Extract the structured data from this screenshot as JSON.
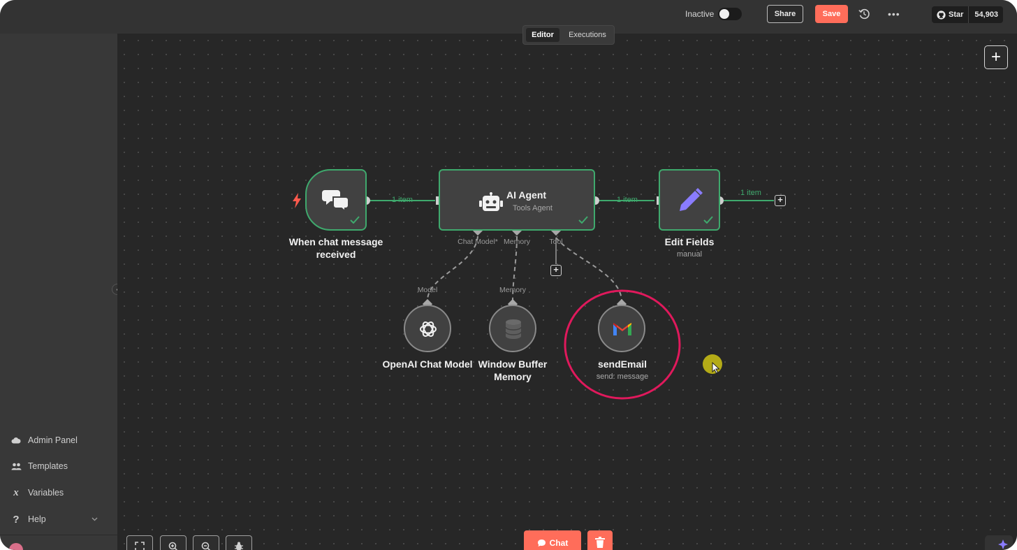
{
  "topbar": {
    "status_label": "Inactive",
    "share_label": "Share",
    "save_label": "Save",
    "more_label": "•••",
    "github": {
      "star_label": "Star",
      "count": "54,903"
    }
  },
  "tabs": [
    {
      "label": "Editor",
      "active": true
    },
    {
      "label": "Executions",
      "active": false
    }
  ],
  "sidebar": {
    "items": [
      {
        "label": "Admin Panel",
        "icon": "cloud-icon"
      },
      {
        "label": "Templates",
        "icon": "users-icon"
      },
      {
        "label": "Variables",
        "icon": "variable-x-icon"
      },
      {
        "label": "Help",
        "icon": "question-icon"
      }
    ]
  },
  "workflow": {
    "nodes": [
      {
        "id": "chat-trigger",
        "label": "When chat message received",
        "icon": "chat-bubbles-icon",
        "status": "success"
      },
      {
        "id": "ai-agent",
        "label": "AI Agent",
        "sublabel": "Tools Agent",
        "icon": "robot-icon",
        "status": "success"
      },
      {
        "id": "edit-fields",
        "label": "Edit Fields",
        "sublabel": "manual",
        "icon": "pencil-icon",
        "status": "success"
      },
      {
        "id": "openai-chat-model",
        "label": "OpenAI Chat Model",
        "icon": "openai-icon"
      },
      {
        "id": "window-buffer-memory",
        "label": "Window Buffer Memory",
        "icon": "database-icon"
      },
      {
        "id": "send-email",
        "label": "sendEmail",
        "sublabel": "send: message",
        "icon": "gmail-icon",
        "highlighted": true
      }
    ],
    "edges": [
      {
        "label": "1 item"
      },
      {
        "label": "1 item"
      },
      {
        "label": "1 item"
      }
    ],
    "agent_inputs": [
      "Chat Model*",
      "Memory",
      "Tool"
    ],
    "sub_inputs": {
      "model": "Model",
      "memory": "Memory"
    }
  },
  "bottom": {
    "chat_label": "Chat"
  },
  "colors": {
    "accent": "#ff6d5a",
    "success": "#3fa96d",
    "highlight_ring": "#e0195c",
    "gmail_red": "#ea4335",
    "edit_icon": "#8a7cff"
  }
}
